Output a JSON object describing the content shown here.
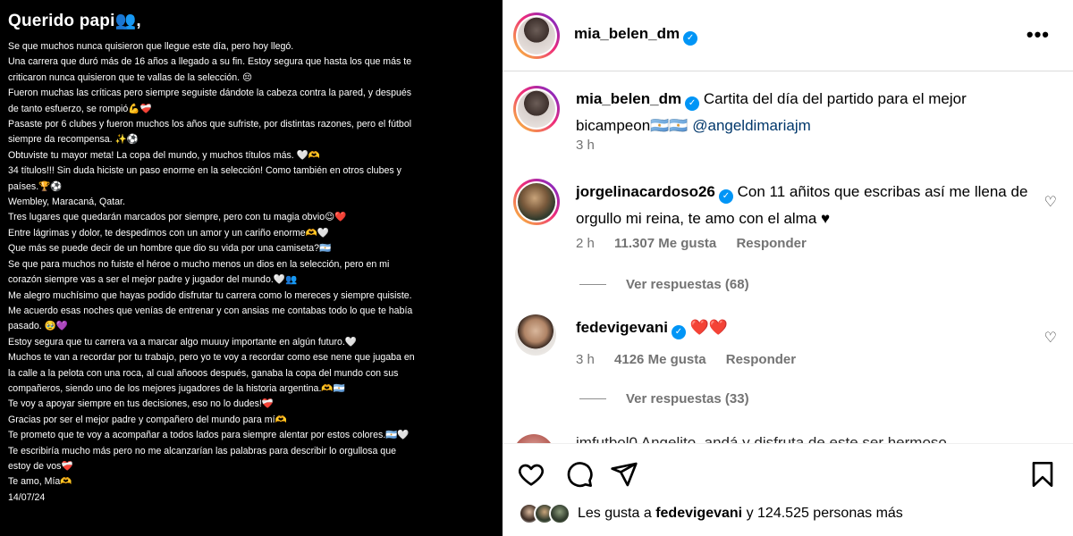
{
  "letter": {
    "title": "Querido papi👥,",
    "lines": [
      "Se que muchos nunca quisieron que llegue este día, pero hoy llegó.",
      "Una carrera que duró más de 16 años a llegado a su fin. Estoy segura que hasta los que más te",
      "criticaron nunca quisieron que te vallas de la selección. 😔",
      "Fueron muchas las críticas pero siempre seguiste dándote la cabeza contra la pared, y después",
      "de tanto esfuerzo, se rompió💪❤️‍🩹",
      "Pasaste por 6 clubes y fueron muchos los años que sufriste, por distintas razones, pero el fútbol",
      "siempre da recompensa. ✨⚽",
      "Obtuviste tu mayor meta! La copa del mundo, y muchos títulos más.        🤍🫶",
      " 34 títulos!!! Sin duda hiciste un paso enorme en la selección! Como también en otros clubes y",
      "países.🏆⚽",
      "Wembley, Maracaná, Qatar.",
      "Tres lugares que quedarán marcados por siempre, pero con  tu magia obvio😉❤️",
      " Entre lágrimas y dolor, te despedimos con un amor y un cariño enorme🫶🤍",
      "  Que más se puede decir de un hombre que dio su vida por una  camiseta?🇦🇷",
      "Se que para muchos no fuiste el héroe o mucho menos un dios en la selección, pero en mi",
      "corazón siempre vas a ser el mejor padre y jugador del mundo.🤍👥",
      "Me alegro muchísimo que hayas podido disfrutar tu carrera como lo mereces y siempre quisiste.",
      "Me acuerdo esas noches que venías de entrenar y con ansias me contabas todo lo que te había",
      "pasado. 🥹💜",
      "Estoy segura que tu carrera va a marcar algo muuuy importante en algún futuro.🤍",
      "Muchos te van a recordar por tu trabajo, pero yo te voy a recordar como ese nene que jugaba en",
      "la calle a la pelota con una roca, al cual añooos después, ganaba la copa del mundo con sus",
      "compañeros, siendo uno de los mejores jugadores de la historia argentina.🫶🇦🇷",
      "Te voy a apoyar siempre en tus decisiones, eso no lo dudes!❤️‍🩹",
      "Gracias por ser el mejor padre y compañero del mundo para mí🫶",
      "Te prometo que te voy a acompañar a todos lados para siempre alentar por estos colores.🇦🇷🤍",
      "Te escribiría mucho más pero no me alcanzarían las palabras para describir lo orgullosa que",
      "estoy de vos❤️‍🩹",
      "Te amo, Mía🫶",
      "14/07/24"
    ]
  },
  "header": {
    "username": "mia_belen_dm",
    "verified": "✓",
    "more": "•••"
  },
  "caption": {
    "username": "mia_belen_dm",
    "text": "Cartita del día del partido para el mejor bicampeon🇦🇷🇦🇷",
    "mention": "@angeldimariajm",
    "time": "3 h"
  },
  "comments": [
    {
      "username": "jorgelinacardoso26",
      "text": "Con 11 añitos que escribas así me llena de orgullo mi reina, te amo con el alma ♥",
      "time": "2 h",
      "likes": "11.307 Me gusta",
      "reply": "Responder",
      "view_replies": "Ver respuestas (68)"
    },
    {
      "username": "fedevigevani",
      "text": "❤️❤️",
      "time": "3 h",
      "likes": "4126 Me gusta",
      "reply": "Responder",
      "view_replies": "Ver respuestas (33)"
    }
  ],
  "peek_comment": "jmfutbol0 Angelito, andá y disfruta de este ser hermoso",
  "likes": {
    "prefix": "Les gusta a",
    "user": "fedevigevani",
    "rest": "y 124.525 personas más"
  },
  "icons": {
    "like": "heart-icon",
    "comment": "comment-icon",
    "share": "share-icon",
    "save": "bookmark-icon",
    "comment_like": "heart-outline-icon"
  },
  "colors": {
    "verified": "#0095f6",
    "mention": "#00376b",
    "meta": "#737373"
  }
}
